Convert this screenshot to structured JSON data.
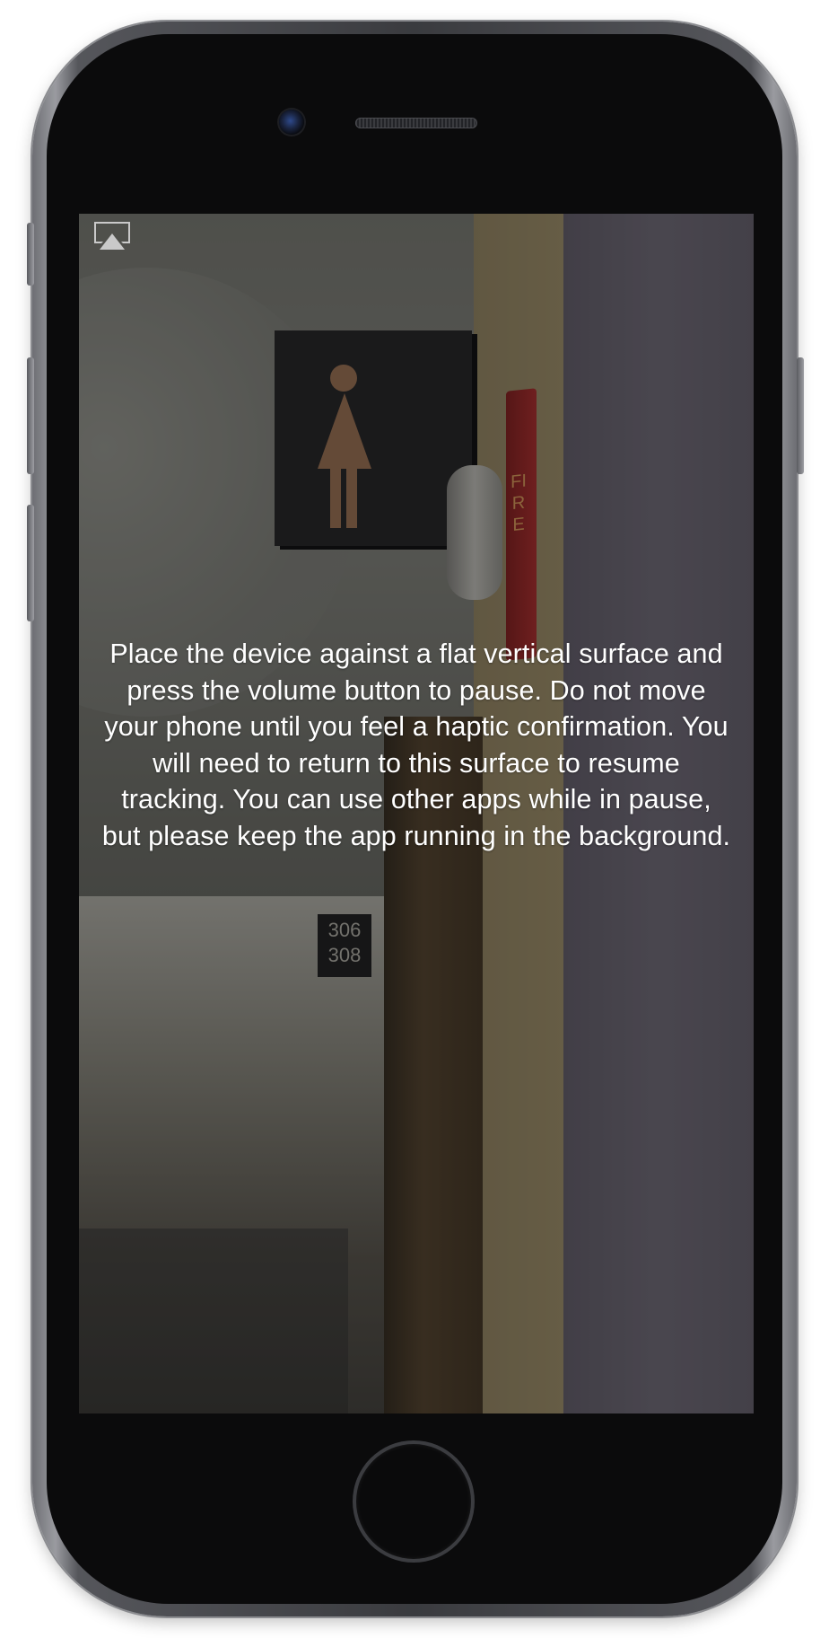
{
  "device": {
    "frame_color": "#3a3b3f",
    "screen_bg": "#5b5a55"
  },
  "icons": {
    "airplay": "airplay-icon"
  },
  "scene": {
    "room_numbers": [
      "306",
      "308"
    ],
    "alarm_label": "FIRE"
  },
  "message": {
    "text": "Place the device against a flat vertical surface and press the volume button to pause. Do not move your phone until you feel a haptic confirmation. You will need to return to this surface to resume tracking. You can use other apps while in pause, but please keep the app running in the background."
  }
}
